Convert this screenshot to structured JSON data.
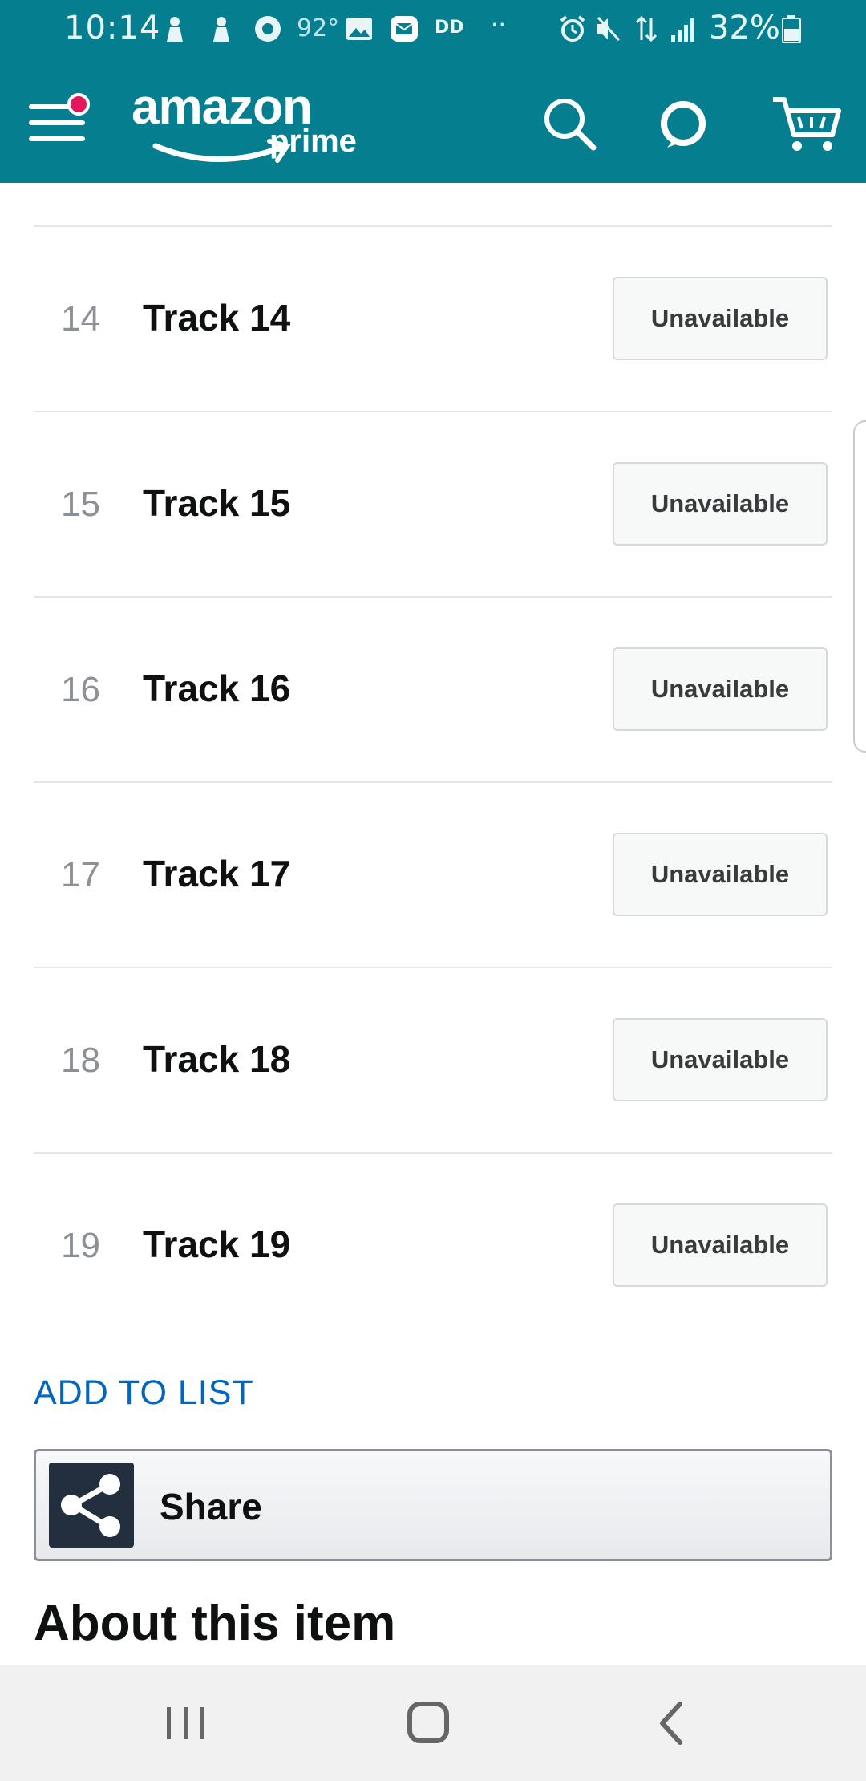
{
  "status_bar": {
    "time": "10:14",
    "temperature": "92°",
    "dd_label": "DD",
    "dots": "··",
    "battery_percent": "32%"
  },
  "header": {
    "logo_word": "amazon",
    "logo_sub": "prime",
    "icons": [
      "menu-icon",
      "search-icon",
      "alexa-icon",
      "cart-icon"
    ],
    "colors": {
      "bar": "#057e90",
      "notification": "#e3175b"
    }
  },
  "tracks": [
    {
      "number": "14",
      "title": "Track 14",
      "status": "Unavailable"
    },
    {
      "number": "15",
      "title": "Track 15",
      "status": "Unavailable"
    },
    {
      "number": "16",
      "title": "Track 16",
      "status": "Unavailable"
    },
    {
      "number": "17",
      "title": "Track 17",
      "status": "Unavailable"
    },
    {
      "number": "18",
      "title": "Track 18",
      "status": "Unavailable"
    },
    {
      "number": "19",
      "title": "Track 19",
      "status": "Unavailable"
    }
  ],
  "actions": {
    "add_to_list": "ADD TO LIST",
    "share_label": "Share",
    "link_color": "#0066c0"
  },
  "section": {
    "about_title": "About this item"
  },
  "nav_bar": {
    "icons": [
      "recent-apps-icon",
      "home-icon",
      "back-icon"
    ]
  }
}
